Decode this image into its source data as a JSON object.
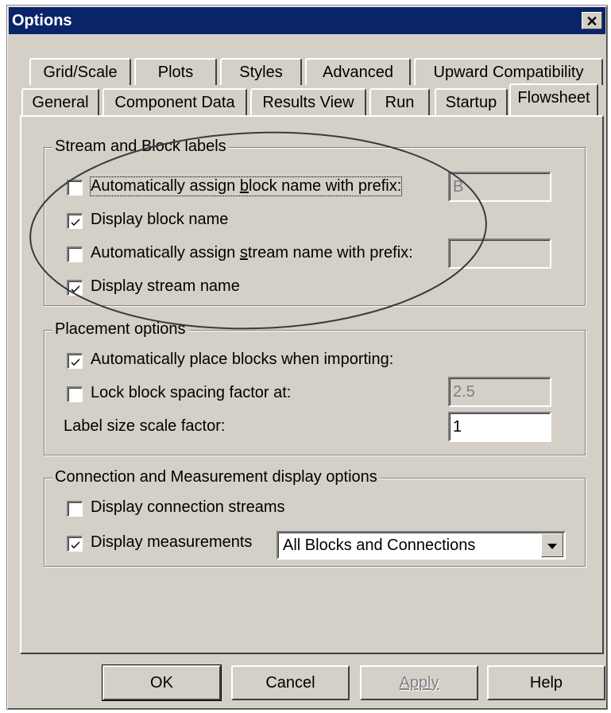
{
  "window": {
    "title": "Options",
    "close_glyph": "✕"
  },
  "tabs_top": [
    "Grid/Scale",
    "Plots",
    "Styles",
    "Advanced",
    "Upward Compatibility"
  ],
  "tabs_bottom": [
    "General",
    "Component Data",
    "Results View",
    "Run",
    "Startup",
    "Flowsheet"
  ],
  "active_tab": "Flowsheet",
  "stream_block_group": {
    "legend": "Stream and Block labels",
    "auto_block": {
      "pre": "Automatically assign ",
      "accel": "b",
      "post": "lock name with prefix:",
      "checked": false,
      "prefix_value": "B"
    },
    "display_block": {
      "label": "Display block name",
      "checked": true
    },
    "auto_stream": {
      "pre": "Automatically assign ",
      "accel": "s",
      "post": "tream name with prefix:",
      "checked": false,
      "prefix_value": ""
    },
    "display_stream": {
      "label": "Display stream name",
      "checked": true
    }
  },
  "placement_group": {
    "legend": "Placement options",
    "auto_place": {
      "label": "Automatically place blocks when importing:",
      "checked": true
    },
    "lock_spacing": {
      "label": "Lock block spacing factor at:",
      "checked": false,
      "value": "2.5"
    },
    "label_scale": {
      "label": "Label size scale factor:",
      "value": "1"
    }
  },
  "connection_group": {
    "legend": "Connection and Measurement display options",
    "display_connection": {
      "label": "Display connection streams",
      "checked": false
    },
    "display_measurements": {
      "label": "Display measurements",
      "checked": true
    },
    "measurements_select": "All Blocks and Connections"
  },
  "buttons": {
    "ok": "OK",
    "cancel": "Cancel",
    "apply": "Apply",
    "help": "Help"
  },
  "annotation_color": "#3a3a3a"
}
